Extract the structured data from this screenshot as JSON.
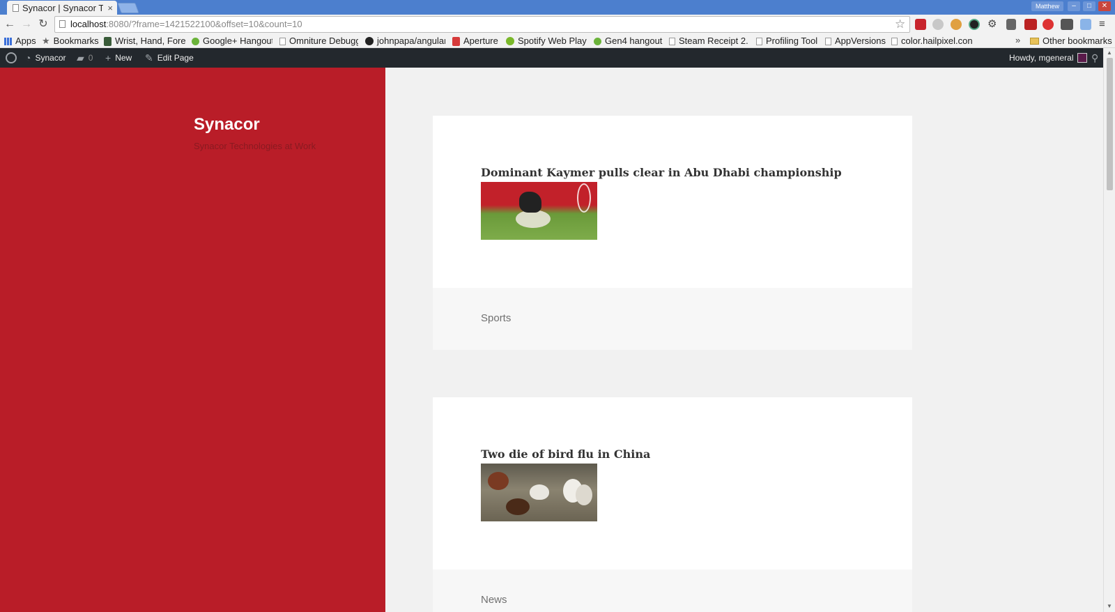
{
  "browser": {
    "tab_title": "Synacor | Synacor Te",
    "tab_close": "×",
    "profile_name": "Matthew",
    "url_host": "localhost",
    "url_rest": ":8080/?frame=1421522100&offset=10&count=10",
    "window_buttons": [
      "–",
      "□",
      "✕"
    ]
  },
  "bookmarks": {
    "items": [
      {
        "label": "Apps",
        "icon": "apps-icon"
      },
      {
        "label": "Bookmarks",
        "icon": "star-icon"
      },
      {
        "label": "Wrist, Hand, Fore",
        "icon": "bookmark-favicon"
      },
      {
        "label": "Google+ Hangout",
        "icon": "hangouts-icon"
      },
      {
        "label": "Omniture Debugg",
        "icon": "page-icon"
      },
      {
        "label": "johnpapa/angular",
        "icon": "github-icon"
      },
      {
        "label": "Aperture",
        "icon": "aperture-icon"
      },
      {
        "label": "Spotify Web Play",
        "icon": "spotify-icon"
      },
      {
        "label": "Gen4 hangout",
        "icon": "hangouts-icon"
      },
      {
        "label": "Steam Receipt 2.",
        "icon": "page-icon"
      },
      {
        "label": "Profiling Tool",
        "icon": "page-icon"
      },
      {
        "label": "AppVersions",
        "icon": "page-icon"
      },
      {
        "label": "color.hailpixel.con",
        "icon": "page-icon"
      }
    ],
    "more": "»",
    "other_bookmarks": "Other bookmarks"
  },
  "adminbar": {
    "site_name": "Synacor",
    "comments_count": "0",
    "new_label": "New",
    "edit_label": "Edit Page",
    "howdy": "Howdy, mgeneral"
  },
  "site": {
    "title": "Synacor",
    "description": "Synacor Technologies at Work"
  },
  "posts": [
    {
      "headline": "Dominant Kaymer pulls clear in Abu Dhabi championship",
      "category": "Sports"
    },
    {
      "headline": "Two die of bird flu in China",
      "category": "News"
    }
  ],
  "colors": {
    "sidebar": "#b91d28",
    "adminbar": "#23282d",
    "chrome_frame": "#4c7fce"
  }
}
